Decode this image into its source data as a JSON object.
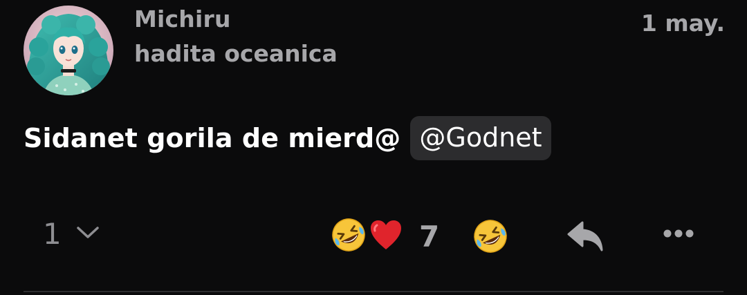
{
  "post": {
    "author_name": "Michiru",
    "author_handle": "hadita oceanica",
    "timestamp": "1 may.",
    "message_text": "Sidanet gorila de mierd@",
    "mention": "@Godnet",
    "reply_count": "1",
    "reaction_count": "7",
    "reactions": [
      "rofl-emoji",
      "red-heart-emoji"
    ],
    "icons": {
      "reply_expand": "chevron-down-icon",
      "add_reaction": "rofl-emoji",
      "reply": "reply-arrow-icon",
      "more": "more-dots-icon"
    }
  },
  "colors": {
    "background": "#0b0b0c",
    "muted_text": "#a7a7aa",
    "mention_bg": "#2c2c2e",
    "emoji_yellow": "#f7c53a",
    "heart_red": "#e0242c"
  }
}
